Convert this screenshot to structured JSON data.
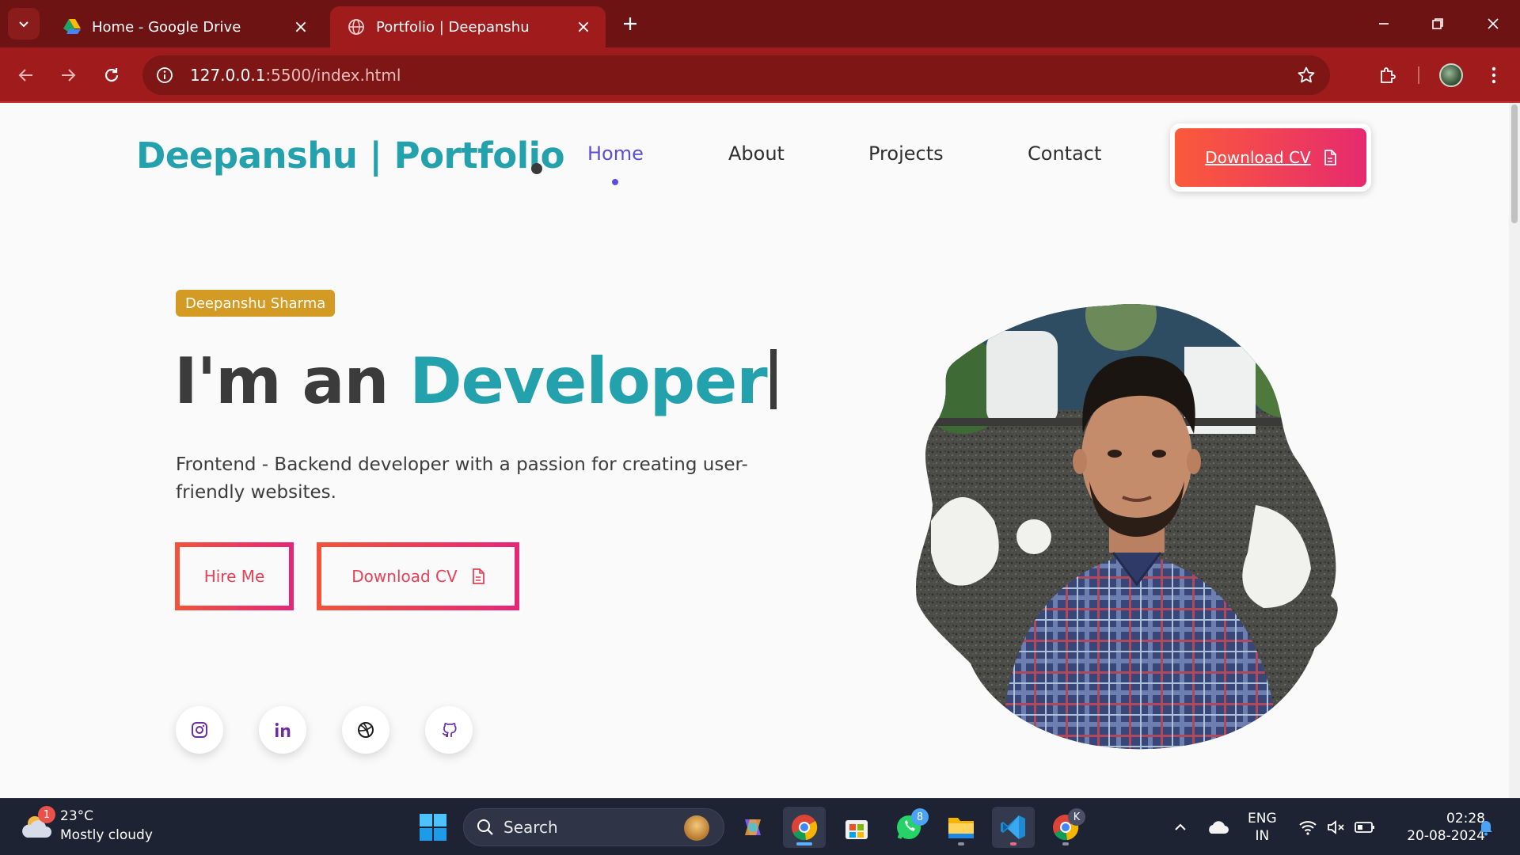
{
  "browser": {
    "tabs": [
      {
        "title": "Home - Google Drive",
        "active": false
      },
      {
        "title": "Portfolio | Deepanshu",
        "active": true
      }
    ],
    "url_host": "127.0.0.1",
    "url_rest": ":5500/index.html",
    "accent": "#a01c1c"
  },
  "nav": {
    "logo": "Deepanshu | Portfolio",
    "links": [
      "Home",
      "About",
      "Projects",
      "Contact"
    ],
    "active": "Home",
    "cv_button": "Download CV"
  },
  "hero": {
    "badge": "Deepanshu Sharma",
    "title_prefix": "I'm an ",
    "title_accent": "Developer",
    "description": "Frontend - Backend developer with a passion for creating user-friendly websites.",
    "hire_button": "Hire Me",
    "cv_button": "Download CV",
    "socials": [
      "instagram-icon",
      "linkedin-icon",
      "dribbble-icon",
      "github-icon"
    ],
    "accent_color": "#23a1ac",
    "badge_color": "#d49b24"
  },
  "taskbar": {
    "weather_temp": "23°C",
    "weather_desc": "Mostly cloudy",
    "weather_badge": "1",
    "search_placeholder": "Search",
    "whatsapp_badge": "8",
    "chrome_profile_letter": "K",
    "lang_line1": "ENG",
    "lang_line2": "IN",
    "time": "02:28",
    "date": "20-08-2024"
  }
}
